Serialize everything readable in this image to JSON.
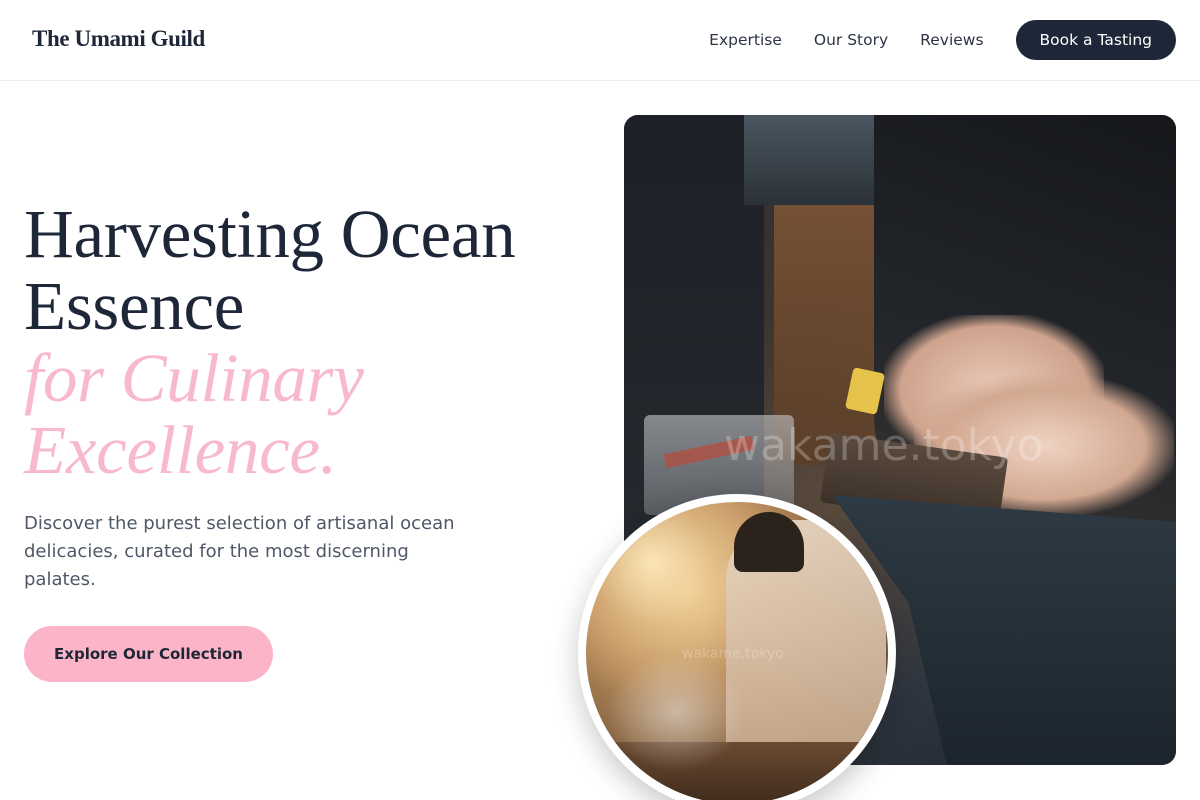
{
  "header": {
    "logo": "The Umami Guild",
    "nav": [
      "Expertise",
      "Our Story",
      "Reviews"
    ],
    "cta": "Book a Tasting"
  },
  "hero": {
    "title_line1": "Harvesting Ocean",
    "title_line2": "Essence",
    "title_accent1": "for Culinary",
    "title_accent2": "Excellence.",
    "description": "Discover the purest selection of artisanal ocean delicacies, curated for the most discerning palates.",
    "cta": "Explore Our Collection"
  },
  "images": {
    "main_watermark": "wakame.tokyo",
    "circle_watermark": "wakame.tokyo"
  },
  "colors": {
    "navy": "#1e2738",
    "pink_accent": "#f7b9cb",
    "pink_button": "#fbb4c8"
  }
}
